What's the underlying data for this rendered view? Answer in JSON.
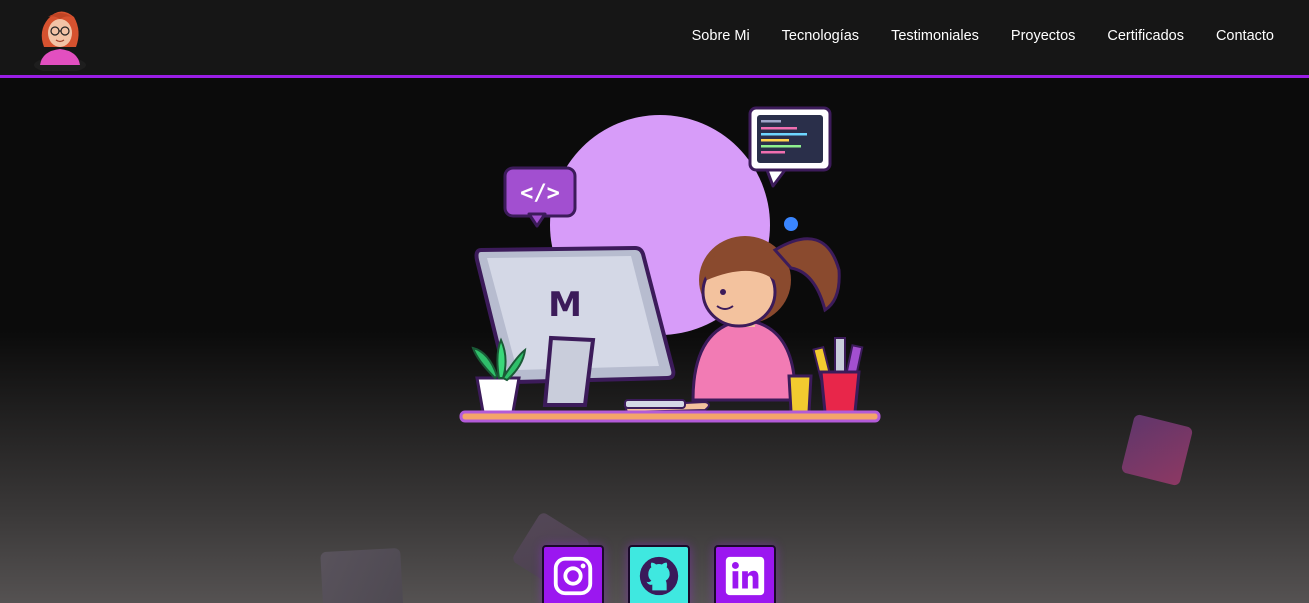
{
  "nav": {
    "logo_alt": "avatar logo",
    "links": [
      {
        "label": "Sobre Mi"
      },
      {
        "label": "Tecnologías"
      },
      {
        "label": "Testimoniales"
      },
      {
        "label": "Proyectos"
      },
      {
        "label": "Certificados"
      },
      {
        "label": "Contacto"
      }
    ]
  },
  "hero": {
    "code_bubble_text": "</>",
    "monitor_logo": "M"
  },
  "socials": [
    {
      "name": "instagram",
      "color": "#9b17f0"
    },
    {
      "name": "github",
      "color": "#3fe8e0"
    },
    {
      "name": "linkedin",
      "color": "#9b17f0"
    }
  ],
  "colors": {
    "accent": "#9a1ee6",
    "navbar_bg": "#161616",
    "hero_circle": "#d79cf9"
  }
}
